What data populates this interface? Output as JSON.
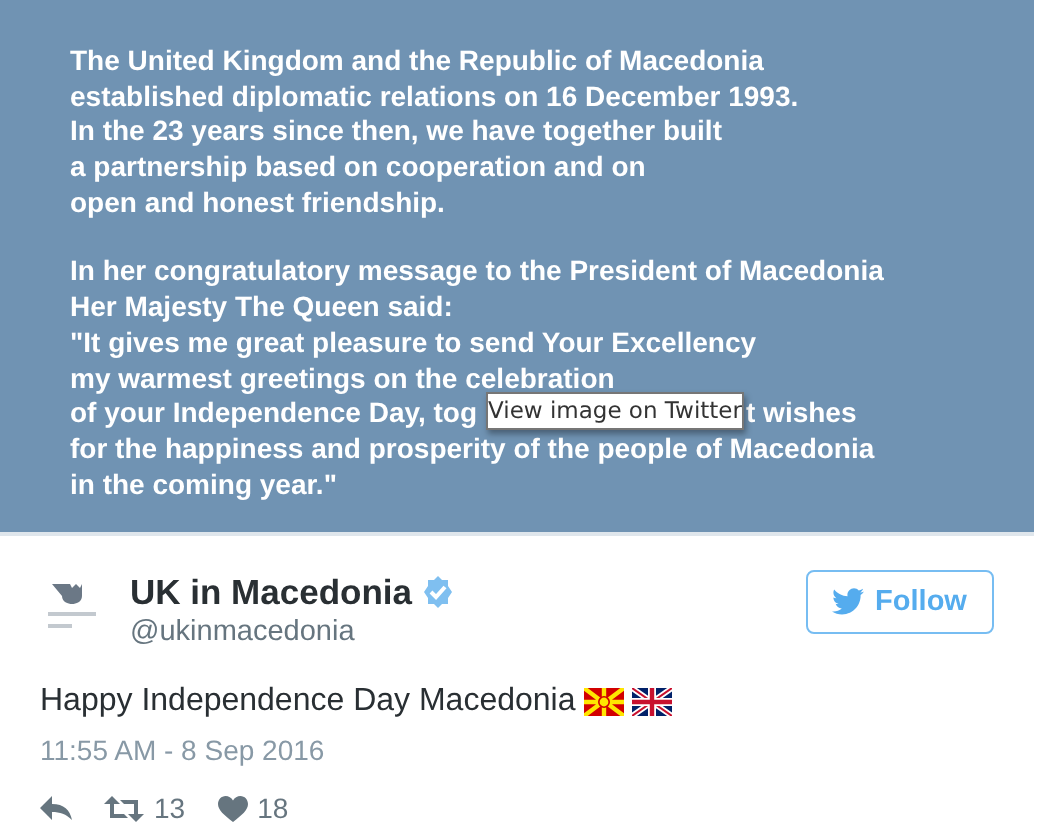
{
  "image": {
    "paragraphs": [
      [
        [
          "The United Kingdom and the Republic of Macedonia"
        ],
        [
          "established diplomatic relations on 16 December 1993."
        ],
        [
          "In the 23 years since then, we have together built"
        ],
        [
          "a partnership based on cooperation and on"
        ],
        [
          "open and honest friendship."
        ]
      ],
      [
        [
          "In her congratulatory message to the President of Macedonia"
        ],
        [
          "Her Majesty The Queen said:"
        ],
        [
          "\"It gives me great pleasure to send Your Excellency"
        ],
        [
          "my warmest greetings on the celebration"
        ],
        [
          "of your Independence Day, tog",
          "t wishes"
        ],
        [
          "for the happiness and prosperity of the people of Macedonia"
        ],
        [
          "in the coming year.\""
        ]
      ]
    ]
  },
  "tooltip": "View image on Twitter",
  "tweet": {
    "author": {
      "name": "UK in Macedonia",
      "handle": "@ukinmacedonia",
      "verified": true
    },
    "follow_button": "Follow",
    "text": "Happy Independence Day Macedonia",
    "timestamp": "11:55 AM - 8 Sep 2016",
    "retweets": "13",
    "likes": "18"
  }
}
